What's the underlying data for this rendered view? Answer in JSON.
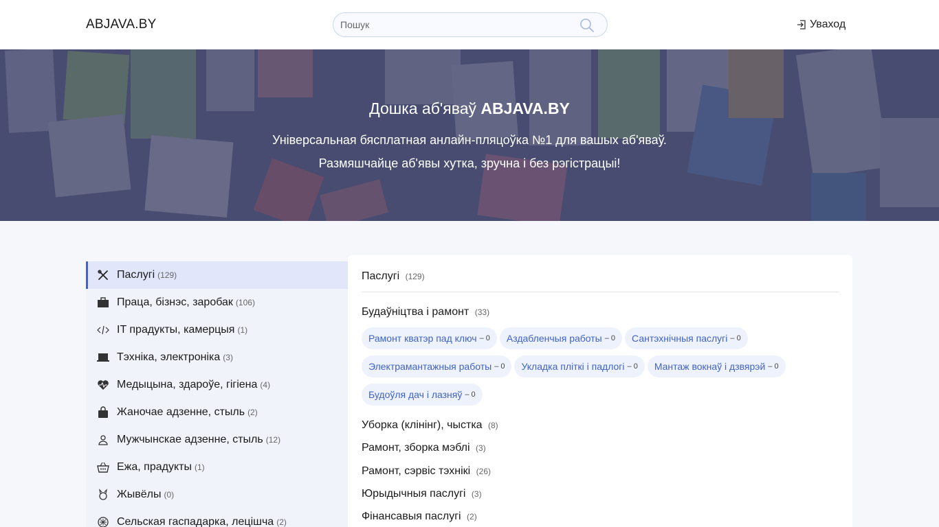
{
  "header": {
    "logo": "ABJAVA.BY",
    "search_placeholder": "Пошук",
    "login_label": "Уваход"
  },
  "hero": {
    "title_prefix": "Дошка аб'яваў ",
    "title_brand": "ABJAVA.BY",
    "subtitle_1": "Універсальная бясплатная анлайн-пляцоўка №1 для вашых аб'яваў.",
    "subtitle_2": "Размяшчайце аб'явы хутка, зручна і без рэгістрацыі!"
  },
  "sidebar": {
    "items": [
      {
        "label": "Паслугі",
        "count": "(129)",
        "icon": "tools-icon"
      },
      {
        "label": "Праца, бізнэс, заробак",
        "count": "(106)",
        "icon": "briefcase-icon"
      },
      {
        "label": "IT прадукты, камерцыя",
        "count": "(1)",
        "icon": "code-icon"
      },
      {
        "label": "Тэхніка, электроніка",
        "count": "(3)",
        "icon": "laptop-icon"
      },
      {
        "label": "Медыцына, здароўе, гігіена",
        "count": "(4)",
        "icon": "heart-pulse-icon"
      },
      {
        "label": "Жаночае адзенне, стыль",
        "count": "(2)",
        "icon": "bag-icon"
      },
      {
        "label": "Мужчынскае адзенне, стыль",
        "count": "(12)",
        "icon": "user-icon"
      },
      {
        "label": "Ежа, прадукты",
        "count": "(1)",
        "icon": "basket-icon"
      },
      {
        "label": "Жывёлы",
        "count": "(0)",
        "icon": "animal-icon"
      },
      {
        "label": "Сельская гаспадарка, лецішча",
        "count": "(2)",
        "icon": "leaf-icon"
      }
    ]
  },
  "panel": {
    "title": "Паслугі",
    "title_count": "(129)",
    "section_1": {
      "label": "Будаўніцтва і рамонт",
      "count": "(33)"
    },
    "chips": [
      {
        "label": "Рамонт кватэр пад ключ",
        "count": "– 0"
      },
      {
        "label": "Аздабленчыя работы",
        "count": "– 0"
      },
      {
        "label": "Сантэхнічныя паслугі",
        "count": "– 0"
      },
      {
        "label": "Электрамантажныя работы",
        "count": "– 0"
      },
      {
        "label": "Укладка пліткі і падлогі",
        "count": "– 0"
      },
      {
        "label": "Мантаж вокнаў і дзвярэй",
        "count": "– 0"
      },
      {
        "label": "Будоўля дач і лазняў",
        "count": "– 0"
      }
    ],
    "sections": [
      {
        "label": "Уборка (клінінг), чыстка",
        "count": "(8)"
      },
      {
        "label": "Рамонт, зборка мэблі",
        "count": "(3)"
      },
      {
        "label": "Рамонт, сэрвіс тэхнікі",
        "count": "(26)"
      },
      {
        "label": "Юрыдычныя паслугі",
        "count": "(3)"
      },
      {
        "label": "Фінансавыя паслугі",
        "count": "(2)"
      }
    ]
  },
  "colors": {
    "accent": "#3c61d8",
    "chip_text": "#3f62c9",
    "chip_bg": "#eef2fc",
    "sidebar_bg": "#f0f3fa",
    "active_bg": "#e1e6fa"
  }
}
